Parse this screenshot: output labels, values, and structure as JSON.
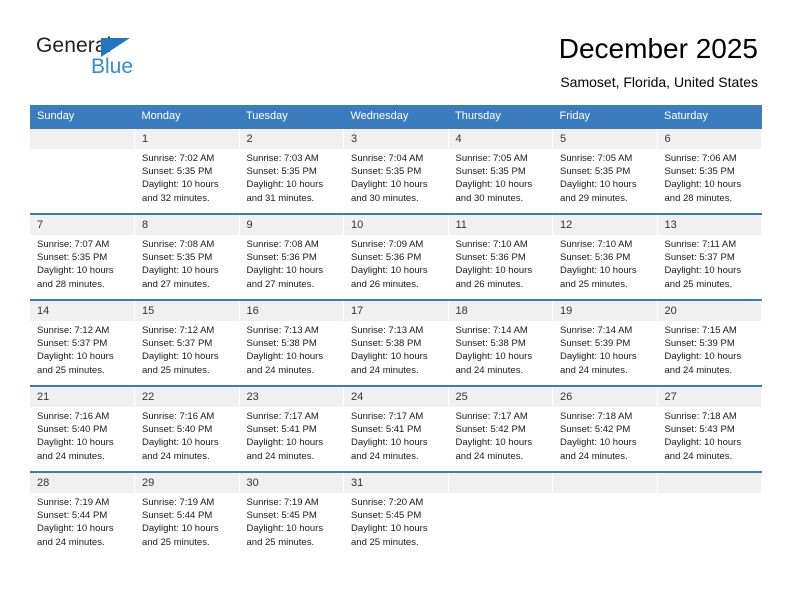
{
  "brand": {
    "name_top": "General",
    "name_bottom": "Blue",
    "triangle_color": "#1f78bf",
    "text_color": "#231f20",
    "blue_color": "#2f8fd4"
  },
  "header": {
    "title": "December 2025",
    "subtitle": "Samoset, Florida, United States"
  },
  "theme": {
    "header_blue": "#3a7cbe",
    "daynum_bg": "#f0f0f0",
    "cell_bg": "#ffffff",
    "text": "#1a1a1a"
  },
  "weekdays": [
    "Sunday",
    "Monday",
    "Tuesday",
    "Wednesday",
    "Thursday",
    "Friday",
    "Saturday"
  ],
  "weeks": [
    [
      {
        "day": ""
      },
      {
        "day": "1",
        "sunrise": "Sunrise: 7:02 AM",
        "sunset": "Sunset: 5:35 PM",
        "daylight1": "Daylight: 10 hours",
        "daylight2": "and 32 minutes."
      },
      {
        "day": "2",
        "sunrise": "Sunrise: 7:03 AM",
        "sunset": "Sunset: 5:35 PM",
        "daylight1": "Daylight: 10 hours",
        "daylight2": "and 31 minutes."
      },
      {
        "day": "3",
        "sunrise": "Sunrise: 7:04 AM",
        "sunset": "Sunset: 5:35 PM",
        "daylight1": "Daylight: 10 hours",
        "daylight2": "and 30 minutes."
      },
      {
        "day": "4",
        "sunrise": "Sunrise: 7:05 AM",
        "sunset": "Sunset: 5:35 PM",
        "daylight1": "Daylight: 10 hours",
        "daylight2": "and 30 minutes."
      },
      {
        "day": "5",
        "sunrise": "Sunrise: 7:05 AM",
        "sunset": "Sunset: 5:35 PM",
        "daylight1": "Daylight: 10 hours",
        "daylight2": "and 29 minutes."
      },
      {
        "day": "6",
        "sunrise": "Sunrise: 7:06 AM",
        "sunset": "Sunset: 5:35 PM",
        "daylight1": "Daylight: 10 hours",
        "daylight2": "and 28 minutes."
      }
    ],
    [
      {
        "day": "7",
        "sunrise": "Sunrise: 7:07 AM",
        "sunset": "Sunset: 5:35 PM",
        "daylight1": "Daylight: 10 hours",
        "daylight2": "and 28 minutes."
      },
      {
        "day": "8",
        "sunrise": "Sunrise: 7:08 AM",
        "sunset": "Sunset: 5:35 PM",
        "daylight1": "Daylight: 10 hours",
        "daylight2": "and 27 minutes."
      },
      {
        "day": "9",
        "sunrise": "Sunrise: 7:08 AM",
        "sunset": "Sunset: 5:36 PM",
        "daylight1": "Daylight: 10 hours",
        "daylight2": "and 27 minutes."
      },
      {
        "day": "10",
        "sunrise": "Sunrise: 7:09 AM",
        "sunset": "Sunset: 5:36 PM",
        "daylight1": "Daylight: 10 hours",
        "daylight2": "and 26 minutes."
      },
      {
        "day": "11",
        "sunrise": "Sunrise: 7:10 AM",
        "sunset": "Sunset: 5:36 PM",
        "daylight1": "Daylight: 10 hours",
        "daylight2": "and 26 minutes."
      },
      {
        "day": "12",
        "sunrise": "Sunrise: 7:10 AM",
        "sunset": "Sunset: 5:36 PM",
        "daylight1": "Daylight: 10 hours",
        "daylight2": "and 25 minutes."
      },
      {
        "day": "13",
        "sunrise": "Sunrise: 7:11 AM",
        "sunset": "Sunset: 5:37 PM",
        "daylight1": "Daylight: 10 hours",
        "daylight2": "and 25 minutes."
      }
    ],
    [
      {
        "day": "14",
        "sunrise": "Sunrise: 7:12 AM",
        "sunset": "Sunset: 5:37 PM",
        "daylight1": "Daylight: 10 hours",
        "daylight2": "and 25 minutes."
      },
      {
        "day": "15",
        "sunrise": "Sunrise: 7:12 AM",
        "sunset": "Sunset: 5:37 PM",
        "daylight1": "Daylight: 10 hours",
        "daylight2": "and 25 minutes."
      },
      {
        "day": "16",
        "sunrise": "Sunrise: 7:13 AM",
        "sunset": "Sunset: 5:38 PM",
        "daylight1": "Daylight: 10 hours",
        "daylight2": "and 24 minutes."
      },
      {
        "day": "17",
        "sunrise": "Sunrise: 7:13 AM",
        "sunset": "Sunset: 5:38 PM",
        "daylight1": "Daylight: 10 hours",
        "daylight2": "and 24 minutes."
      },
      {
        "day": "18",
        "sunrise": "Sunrise: 7:14 AM",
        "sunset": "Sunset: 5:38 PM",
        "daylight1": "Daylight: 10 hours",
        "daylight2": "and 24 minutes."
      },
      {
        "day": "19",
        "sunrise": "Sunrise: 7:14 AM",
        "sunset": "Sunset: 5:39 PM",
        "daylight1": "Daylight: 10 hours",
        "daylight2": "and 24 minutes."
      },
      {
        "day": "20",
        "sunrise": "Sunrise: 7:15 AM",
        "sunset": "Sunset: 5:39 PM",
        "daylight1": "Daylight: 10 hours",
        "daylight2": "and 24 minutes."
      }
    ],
    [
      {
        "day": "21",
        "sunrise": "Sunrise: 7:16 AM",
        "sunset": "Sunset: 5:40 PM",
        "daylight1": "Daylight: 10 hours",
        "daylight2": "and 24 minutes."
      },
      {
        "day": "22",
        "sunrise": "Sunrise: 7:16 AM",
        "sunset": "Sunset: 5:40 PM",
        "daylight1": "Daylight: 10 hours",
        "daylight2": "and 24 minutes."
      },
      {
        "day": "23",
        "sunrise": "Sunrise: 7:17 AM",
        "sunset": "Sunset: 5:41 PM",
        "daylight1": "Daylight: 10 hours",
        "daylight2": "and 24 minutes."
      },
      {
        "day": "24",
        "sunrise": "Sunrise: 7:17 AM",
        "sunset": "Sunset: 5:41 PM",
        "daylight1": "Daylight: 10 hours",
        "daylight2": "and 24 minutes."
      },
      {
        "day": "25",
        "sunrise": "Sunrise: 7:17 AM",
        "sunset": "Sunset: 5:42 PM",
        "daylight1": "Daylight: 10 hours",
        "daylight2": "and 24 minutes."
      },
      {
        "day": "26",
        "sunrise": "Sunrise: 7:18 AM",
        "sunset": "Sunset: 5:42 PM",
        "daylight1": "Daylight: 10 hours",
        "daylight2": "and 24 minutes."
      },
      {
        "day": "27",
        "sunrise": "Sunrise: 7:18 AM",
        "sunset": "Sunset: 5:43 PM",
        "daylight1": "Daylight: 10 hours",
        "daylight2": "and 24 minutes."
      }
    ],
    [
      {
        "day": "28",
        "sunrise": "Sunrise: 7:19 AM",
        "sunset": "Sunset: 5:44 PM",
        "daylight1": "Daylight: 10 hours",
        "daylight2": "and 24 minutes."
      },
      {
        "day": "29",
        "sunrise": "Sunrise: 7:19 AM",
        "sunset": "Sunset: 5:44 PM",
        "daylight1": "Daylight: 10 hours",
        "daylight2": "and 25 minutes."
      },
      {
        "day": "30",
        "sunrise": "Sunrise: 7:19 AM",
        "sunset": "Sunset: 5:45 PM",
        "daylight1": "Daylight: 10 hours",
        "daylight2": "and 25 minutes."
      },
      {
        "day": "31",
        "sunrise": "Sunrise: 7:20 AM",
        "sunset": "Sunset: 5:45 PM",
        "daylight1": "Daylight: 10 hours",
        "daylight2": "and 25 minutes."
      },
      {
        "day": ""
      },
      {
        "day": ""
      },
      {
        "day": ""
      }
    ]
  ]
}
